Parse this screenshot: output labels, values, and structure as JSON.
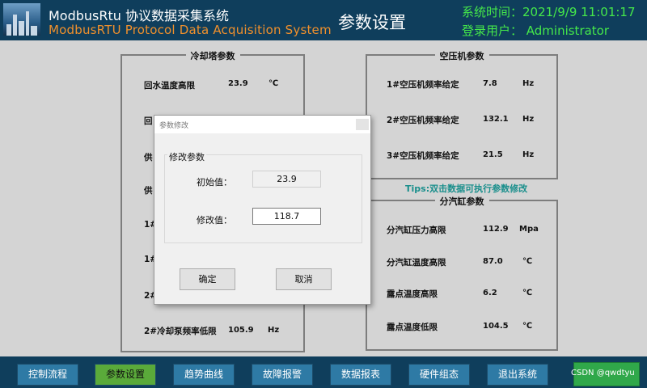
{
  "header": {
    "app_title_cn": "ModbusRtu 协议数据采集系统",
    "app_title_en": "ModbusRTU Protocol Data Acquisition System",
    "page_title": "参数设置",
    "system_time": "系统时间：2021/9/9 11:01:17",
    "login_user": "登录用户： Administrator"
  },
  "cooling_tower": {
    "title": "冷却塔参数",
    "rows": [
      {
        "label": "回水温度高限",
        "value": "23.9",
        "unit": "℃"
      },
      {
        "label": "回"
      },
      {
        "label": "供"
      },
      {
        "label": "供"
      },
      {
        "label": "1#"
      },
      {
        "label": "1#"
      },
      {
        "label": "2#"
      },
      {
        "label": "2#冷却泵频率低限",
        "value": "105.9",
        "unit": "Hz"
      }
    ]
  },
  "air_compressor": {
    "title": "空压机参数",
    "rows": [
      {
        "label": "1#空压机频率给定",
        "value": "7.8",
        "unit": "Hz"
      },
      {
        "label": "2#空压机频率给定",
        "value": "132.1",
        "unit": "Hz"
      },
      {
        "label": "3#空压机频率给定",
        "value": "21.5",
        "unit": "Hz"
      }
    ]
  },
  "tips": "Tips:双击数据可执行参数修改",
  "steam_header": {
    "title": "分汽缸参数",
    "rows": [
      {
        "label": "分汽缸压力高限",
        "value": "112.9",
        "unit": "Mpa"
      },
      {
        "label": "分汽缸温度高限",
        "value": "87.0",
        "unit": "℃"
      },
      {
        "label": "露点温度高限",
        "value": "6.2",
        "unit": "℃"
      },
      {
        "label": "露点温度低限",
        "value": "104.5",
        "unit": "℃"
      }
    ]
  },
  "dialog": {
    "title": "参数修改",
    "group_label": "修改参数",
    "initial_label": "初始值：",
    "initial_value": "23.9",
    "modify_label": "修改值：",
    "modify_value": "118.7",
    "ok_label": "确定",
    "cancel_label": "取消"
  },
  "nav": {
    "items": [
      "控制流程",
      "参数设置",
      "趋势曲线",
      "故障报警",
      "数据报表",
      "硬件组态",
      "退出系统"
    ],
    "active": "参数设置"
  },
  "watermark": "CSDN @qwdtyu",
  "colors": {
    "header_bg": "#0f3e5c",
    "accent_green": "#45e84a",
    "accent_orange": "#f0902c",
    "nav_button": "#2e7aa5",
    "nav_active": "#5aaa3a",
    "tips": "#1a8f8c"
  }
}
